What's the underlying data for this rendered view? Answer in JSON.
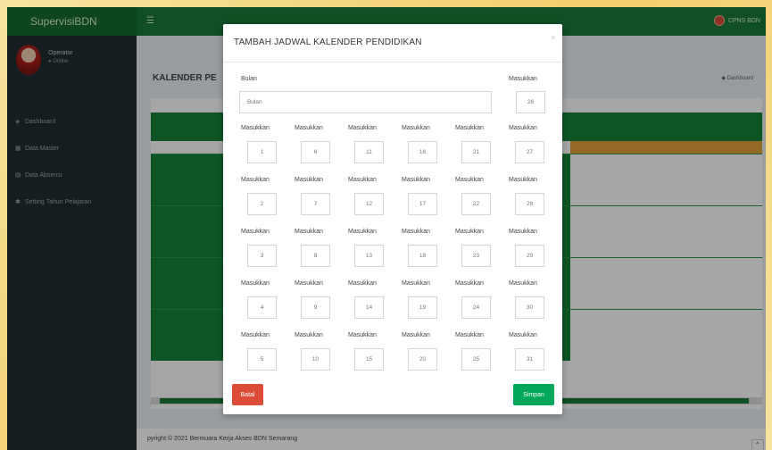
{
  "app": {
    "brand": "SupervisiBDN",
    "toggle_icon": "☰",
    "user_label": "CPNS BDN"
  },
  "sidebar": {
    "user_name": "Operator",
    "user_status": "● Online",
    "items": [
      {
        "icon": "dashboard-icon",
        "glyph": "◈",
        "label": "Dashboard"
      },
      {
        "icon": "table-icon",
        "glyph": "▦",
        "label": "Data Master"
      },
      {
        "icon": "calendar-icon",
        "glyph": "▤",
        "label": "Data Absensi"
      },
      {
        "icon": "gear-icon",
        "glyph": "✱",
        "label": "Setting Tahun Pelajaran"
      }
    ]
  },
  "content": {
    "page_title": "KALENDER PE",
    "breadcrumb": "◆ Dashboard",
    "footer": "pyright © 2021 Bermuara Kerja Akses BDN Semarang"
  },
  "modal": {
    "title": "TAMBAH JADWAL KALENDER PENDIDIKAN",
    "close_glyph": "×",
    "bulan_label": "Bulan",
    "bulan_placeholder": "Bulan",
    "first_label": "Masukkan",
    "first_placeholder": "26",
    "grid_label": "Masukkan",
    "grid": [
      [
        "1",
        "6",
        "11",
        "16",
        "21",
        "27"
      ],
      [
        "2",
        "7",
        "12",
        "17",
        "22",
        "28"
      ],
      [
        "3",
        "8",
        "13",
        "18",
        "23",
        "29"
      ],
      [
        "4",
        "9",
        "14",
        "19",
        "24",
        "30"
      ],
      [
        "5",
        "10",
        "15",
        "20",
        "25",
        "31"
      ]
    ],
    "batal_label": "Batal",
    "simpan_label": "Simpan"
  },
  "colors": {
    "navbar": "#1a7a3a",
    "sidebar": "#222d32",
    "danger": "#dd4b39",
    "success": "#00a65a"
  }
}
